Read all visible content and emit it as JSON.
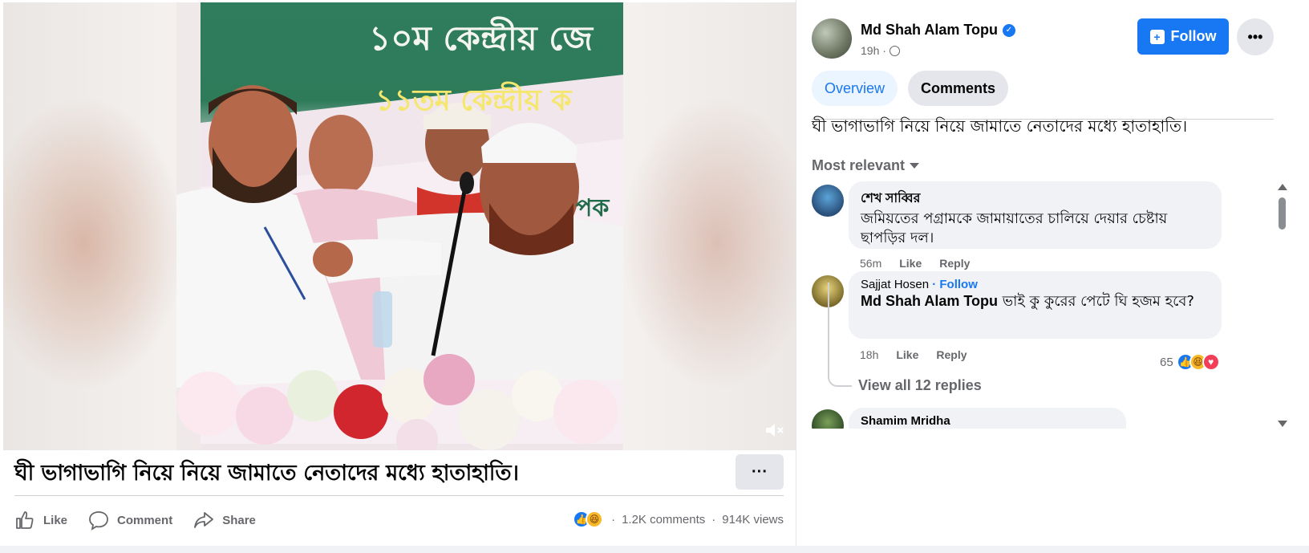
{
  "video": {
    "banner_line1": "১০ম কেন্দ্রীয় জে",
    "banner_line2": "১১তম কেন্দ্রীয় ক",
    "banner_side": "পক",
    "mute_icon": "volume-muted-icon"
  },
  "post": {
    "caption": "ঘী ভাগাভাগি নিয়ে নিয়ে জামাতে নেতাদের মধ্যে হাতাহাতি।",
    "more_label": "···",
    "actions": {
      "like": "Like",
      "comment": "Comment",
      "share": "Share"
    },
    "stats": {
      "comments": "1.2K comments",
      "views": "914K views",
      "sep": "·"
    }
  },
  "author": {
    "name": "Md Shah Alam Topu",
    "time": "19h ·",
    "follow_label": "Follow",
    "more_label": "•••"
  },
  "tabs": {
    "overview": "Overview",
    "comments": "Comments"
  },
  "panel_post_text": "ঘী ভাগাভাগি নিয়ে নিয়ে জামাতে নেতাদের মধ্যে হাতাহাতি।",
  "sort_label": "Most relevant",
  "comments": [
    {
      "name": "শেখ সাব্বির",
      "text": "জমিয়তের পগ্রামকে জামায়াতের চালিয়ে দেয়ার চেষ্টায় ছাপড়ির দল।",
      "time": "56m",
      "like": "Like",
      "reply": "Reply"
    },
    {
      "name": "Sajjat Hosen",
      "follow": "· Follow",
      "mention": "Md Shah Alam Topu",
      "text": " ভাই কু কুরের পেটে ঘি হজম হবে?",
      "time": "18h",
      "like": "Like",
      "reply": "Reply",
      "reactions_count": "65",
      "view_replies": "View all 12 replies"
    },
    {
      "name": "Shamim Mridha"
    }
  ],
  "colors": {
    "accent": "#1877f2",
    "secondary_text": "#65676b",
    "bubble": "#f0f2f5"
  }
}
